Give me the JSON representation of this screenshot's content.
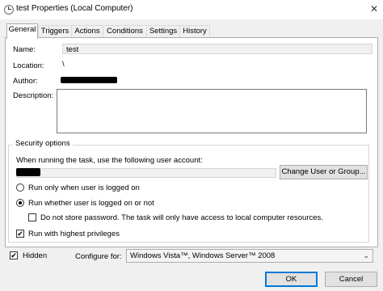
{
  "window": {
    "title": "test Properties (Local Computer)",
    "close_glyph": "✕"
  },
  "tabs": [
    {
      "label": "General",
      "active": true
    },
    {
      "label": "Triggers"
    },
    {
      "label": "Actions"
    },
    {
      "label": "Conditions"
    },
    {
      "label": "Settings"
    },
    {
      "label": "History"
    }
  ],
  "general": {
    "name_label": "Name:",
    "name_value": "test",
    "location_label": "Location:",
    "location_value": "\\",
    "author_label": "Author:",
    "description_label": "Description:",
    "description_value": ""
  },
  "security": {
    "group_label": "Security options",
    "account_prompt": "When running the task, use the following user account:",
    "change_user_button": "Change User or Group...",
    "radio_logged_on": "Run only when user is logged on",
    "radio_whether": "Run whether user is logged on or not",
    "selected_option": "Run whether user is logged on or not",
    "no_store_password": "Do not store password.  The task will only have access to local computer resources.",
    "no_store_password_checked": false,
    "highest_privileges": "Run with highest privileges",
    "highest_privileges_checked": true
  },
  "footer": {
    "hidden_label": "Hidden",
    "hidden_checked": true,
    "configure_label": "Configure for:",
    "configure_value": "Windows Vista™, Windows Server™ 2008",
    "ok_button": "OK",
    "cancel_button": "Cancel"
  },
  "icons": [
    "task-scheduler-clock-icon",
    "close-icon",
    "dropdown-arrow-icon",
    "checkmark-icon"
  ],
  "colors": {
    "dialog_bg": "#f0f0f0",
    "panel_bg": "#ffffff",
    "default_button_border": "#0078d7"
  }
}
